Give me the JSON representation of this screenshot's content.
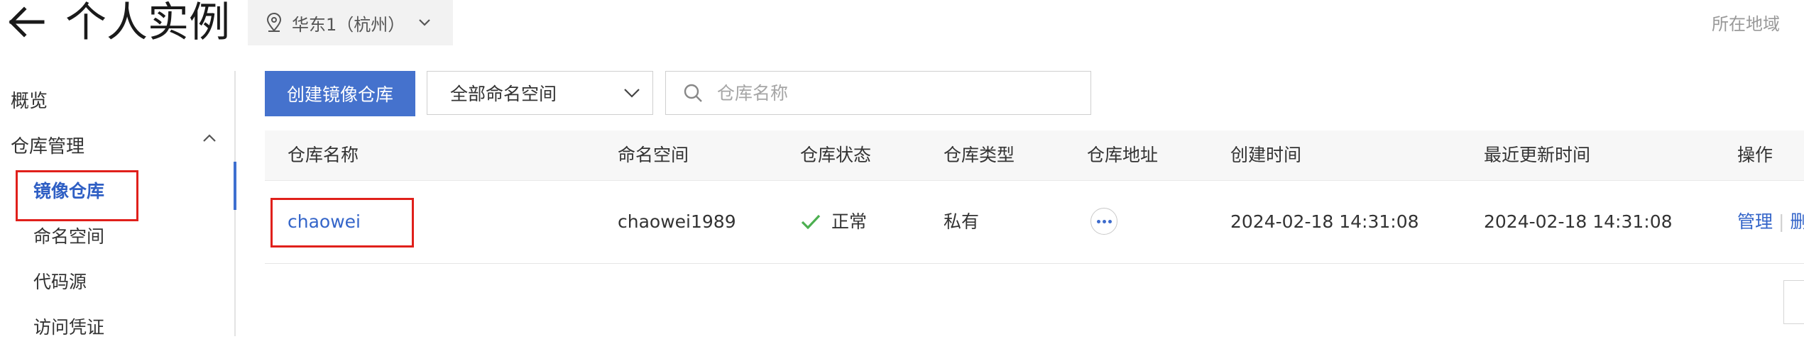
{
  "header": {
    "title": "个人实例",
    "region": "华东1（杭州）",
    "region_hint": "所在地域"
  },
  "sidebar": {
    "items": [
      {
        "label": "概览"
      },
      {
        "label": "仓库管理"
      }
    ],
    "sub_items": [
      {
        "label": "镜像仓库",
        "active": true
      },
      {
        "label": "命名空间"
      },
      {
        "label": "代码源"
      },
      {
        "label": "访问凭证"
      }
    ]
  },
  "toolbar": {
    "create_label": "创建镜像仓库",
    "namespace_select": "全部命名空间",
    "search_placeholder": "仓库名称"
  },
  "table": {
    "columns": [
      "仓库名称",
      "命名空间",
      "仓库状态",
      "仓库类型",
      "仓库地址",
      "创建时间",
      "最近更新时间",
      "操作"
    ],
    "rows": [
      {
        "name": "chaowei",
        "namespace": "chaowei1989",
        "status": "正常",
        "type": "私有",
        "created": "2024-02-18 14:31:08",
        "updated": "2024-02-18 14:31:08",
        "action_manage": "管理",
        "action_delete": "删"
      }
    ]
  },
  "colors": {
    "primary": "#4572cd",
    "link": "#3465c9",
    "highlight": "#e0201b",
    "status_ok": "#4caf50"
  },
  "icons": [
    "back-arrow-icon",
    "location-pin-icon",
    "chevron-down-icon",
    "chevron-up-icon",
    "search-icon",
    "check-icon",
    "more-icon"
  ]
}
